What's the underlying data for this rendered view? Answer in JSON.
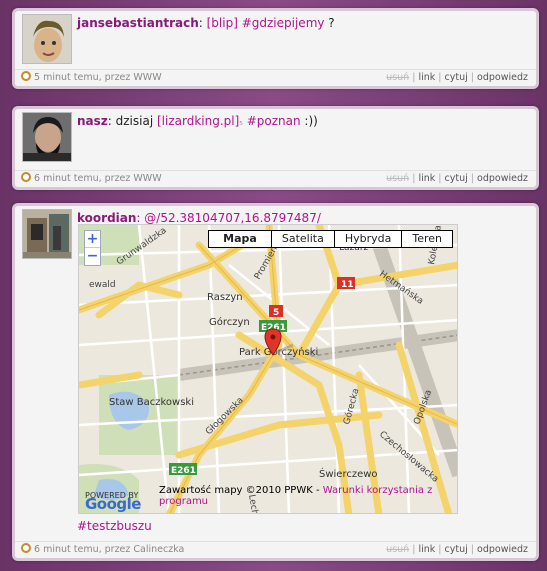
{
  "posts": [
    {
      "author": "jansebastiantrach",
      "text_parts": [
        ": ",
        "[blip]",
        " ",
        "#gdziepijemy",
        " ?"
      ],
      "footer_time": "5 minut temu, przez WWW",
      "actions": {
        "delete": "usuń",
        "link": "link",
        "quote": "cytuj",
        "reply": "odpowiedz"
      }
    },
    {
      "author": "nasz",
      "text_parts": [
        ": dzisiaj ",
        "[lizardking.pl]",
        "₅",
        " ",
        "#poznan",
        " :))"
      ],
      "footer_time": "6 minut temu, przez WWW",
      "actions": {
        "delete": "usuń",
        "link": "link",
        "quote": "cytuj",
        "reply": "odpowiedz"
      }
    },
    {
      "author": "koordian",
      "coords": ": @/52.38104707,16.8797487/",
      "tag": "#testzbuszu",
      "footer_time": "6 minut temu, przez Calineczka",
      "actions": {
        "delete": "usuń",
        "link": "link",
        "quote": "cytuj",
        "reply": "odpowiedz"
      },
      "map": {
        "types": [
          "Mapa",
          "Satelita",
          "Hybryda",
          "Teren"
        ],
        "zoom_in": "+",
        "zoom_out": "−",
        "copyright": "Zawartość mapy ©2010 PPWK - ",
        "terms": "Warunki korzystania z programu",
        "logo_top": "POWERED BY",
        "logo": "Google",
        "labels": [
          "Grunwaldzka",
          "Promienista",
          "Raszyn",
          "Górczyn",
          "Park Górczyński",
          "Staw Baczkowski",
          "Staw",
          "Głogowska",
          "Świerczewo",
          "Łazarz",
          "Hetmańska",
          "Głogowska",
          "Czechosłowacka",
          "Opolska",
          "Górecka",
          "Lechicka",
          "Kolejowa",
          "ewald"
        ],
        "road_badges": [
          "5",
          "E261",
          "11",
          "E261"
        ]
      }
    }
  ]
}
